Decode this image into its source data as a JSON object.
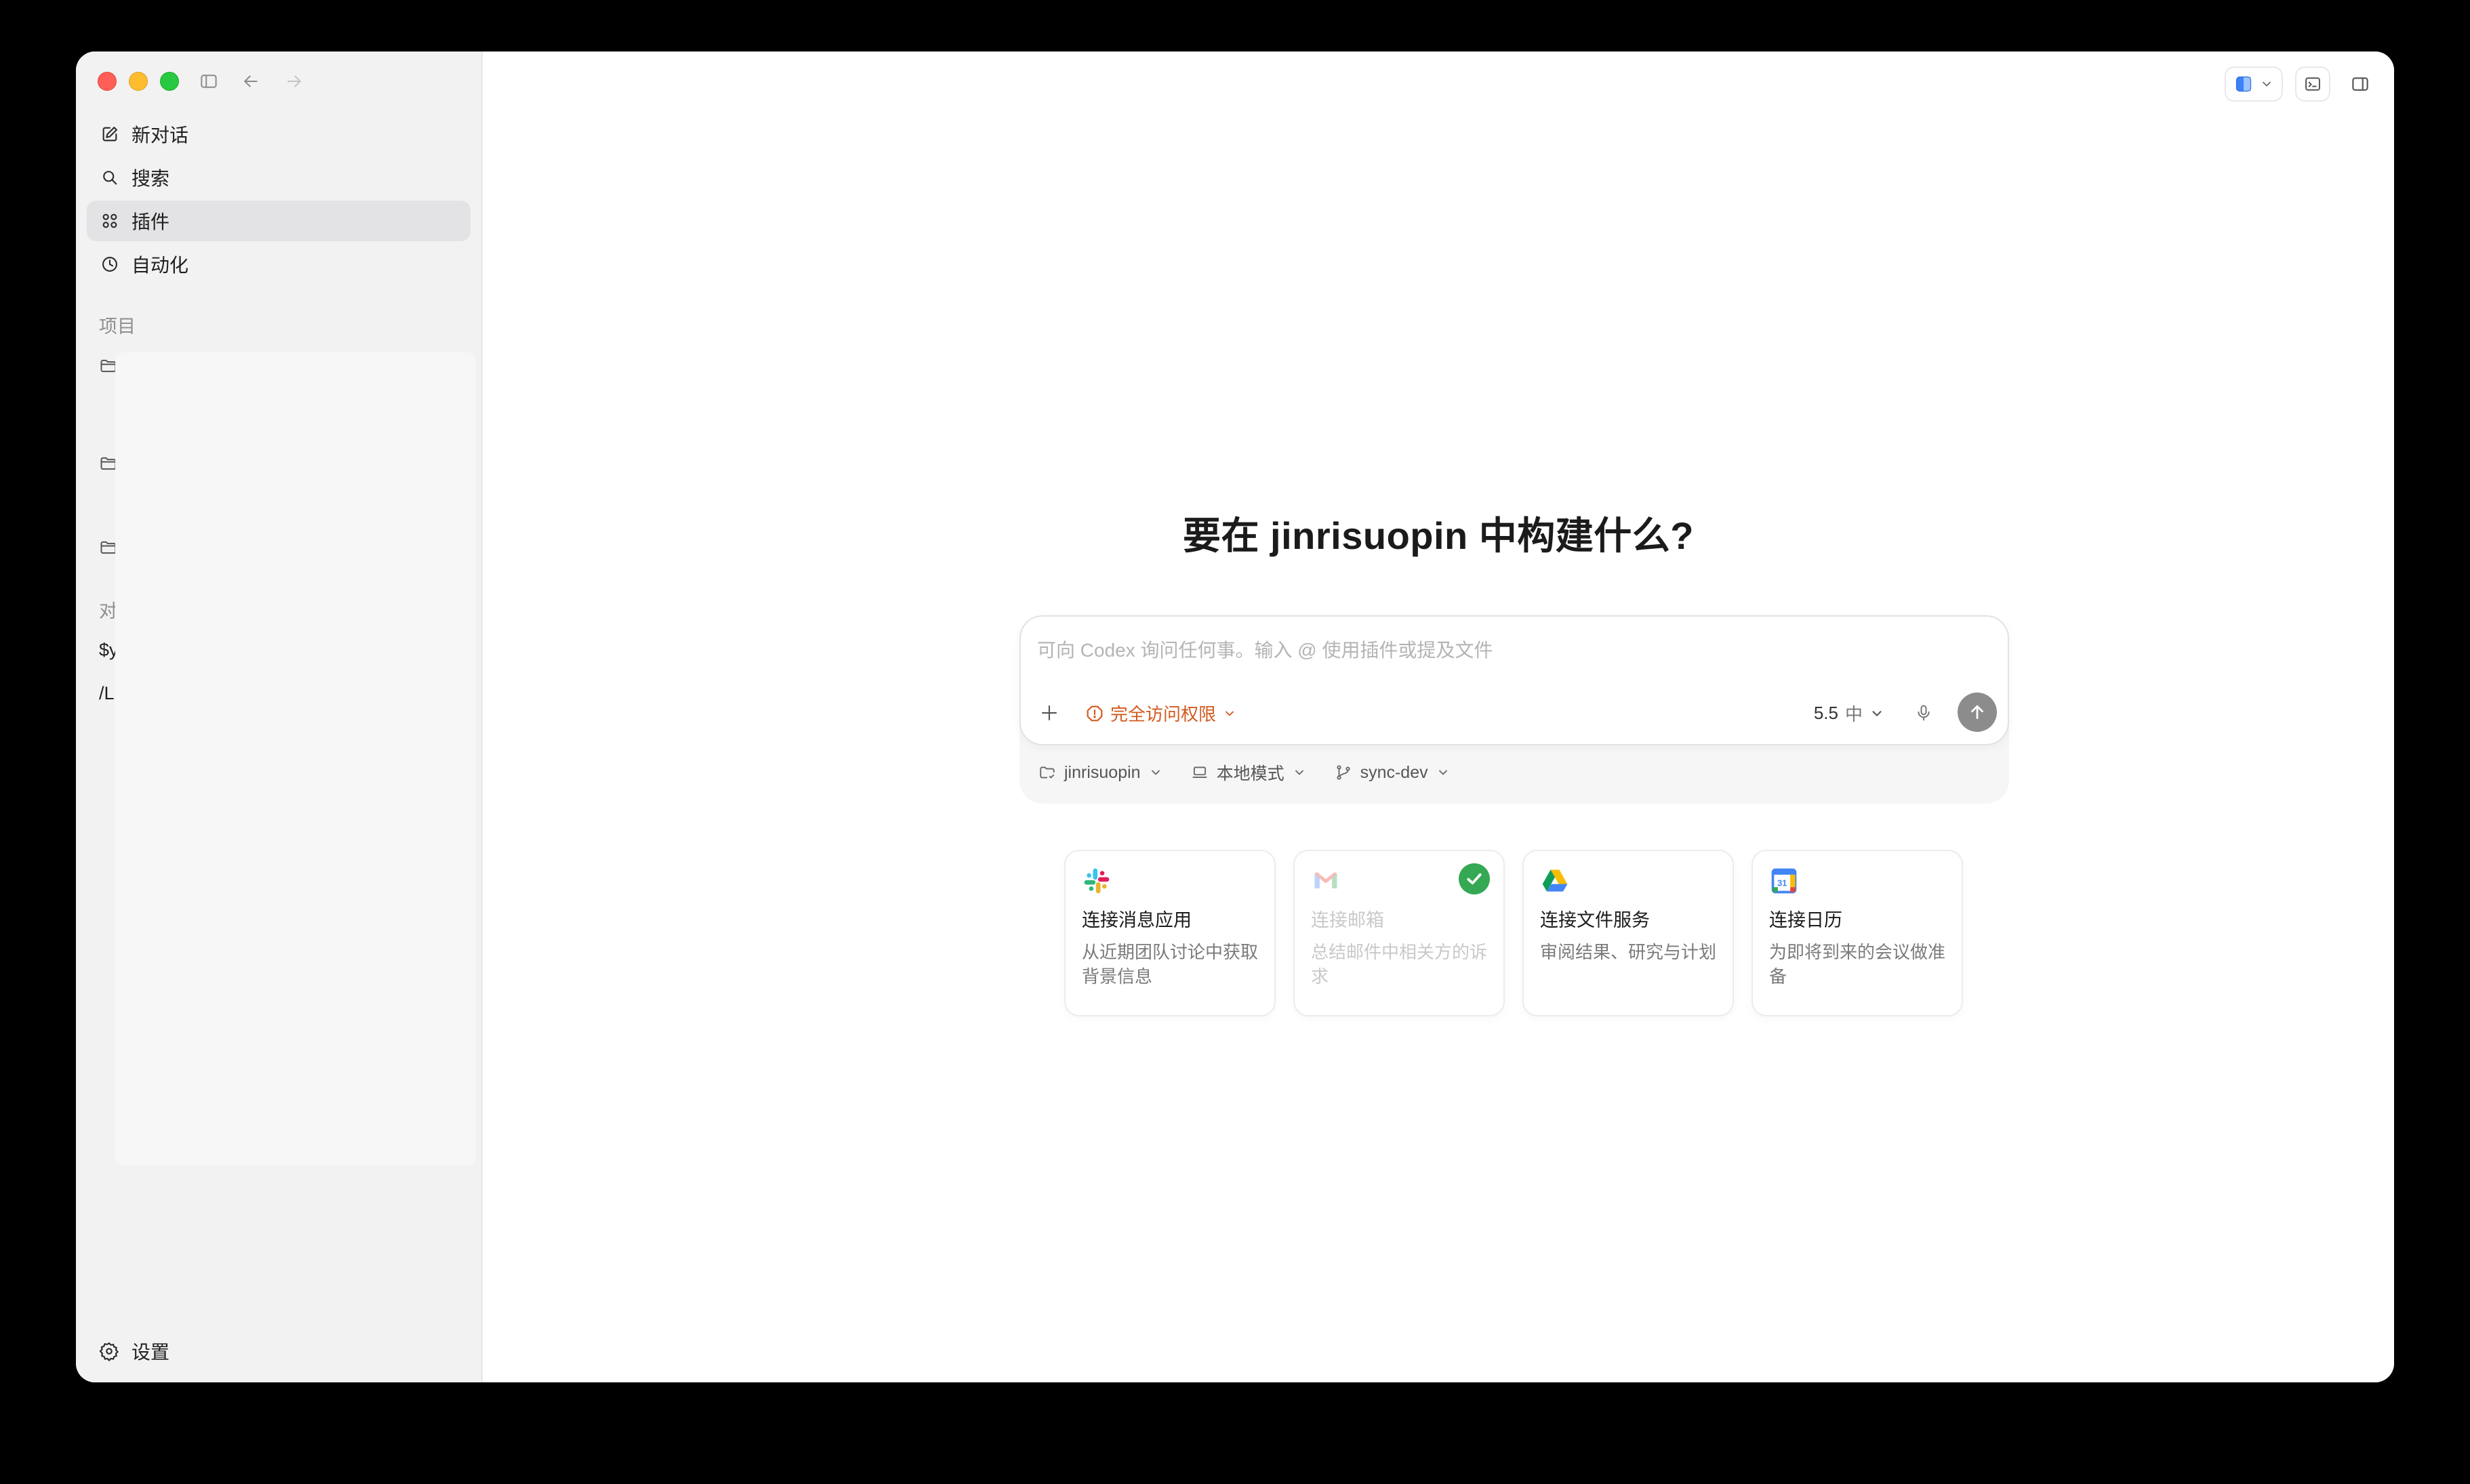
{
  "sidebar": {
    "nav": [
      {
        "label": "新对话",
        "icon": "edit-icon"
      },
      {
        "label": "搜索",
        "icon": "search-icon"
      },
      {
        "label": "插件",
        "icon": "plugins-grid-icon",
        "active": true
      },
      {
        "label": "自动化",
        "icon": "clock-icon"
      }
    ],
    "projects_label": "项目",
    "chats_label_partial": "对",
    "chat_items_partial": [
      "$y",
      "/L"
    ],
    "settings_label": "设置"
  },
  "main": {
    "headline": "要在 jinrisuopin 中构建什么?",
    "composer": {
      "placeholder": "可向 Codex 询问任何事。输入 @ 使用插件或提及文件",
      "permission_label": "完全访问权限",
      "model_version": "5.5",
      "model_effort": "中"
    },
    "context": {
      "workspace": "jinrisuopin",
      "mode": "本地模式",
      "branch": "sync-dev"
    },
    "cards": [
      {
        "title": "连接消息应用",
        "desc": "从近期团队讨论中获取背景信息",
        "icon": "slack-icon",
        "connected": false
      },
      {
        "title": "连接邮箱",
        "desc": "总结邮件中相关方的诉求",
        "icon": "gmail-icon",
        "connected": true
      },
      {
        "title": "连接文件服务",
        "desc": "审阅结果、研究与计划",
        "icon": "google-drive-icon",
        "connected": false
      },
      {
        "title": "连接日历",
        "desc": "为即将到来的会议做准备",
        "icon": "google-calendar-icon",
        "connected": false
      }
    ]
  },
  "colors": {
    "accent_warning": "#d35a1f",
    "sidebar_bg": "#f2f2f2",
    "connected_green": "#35a853"
  }
}
